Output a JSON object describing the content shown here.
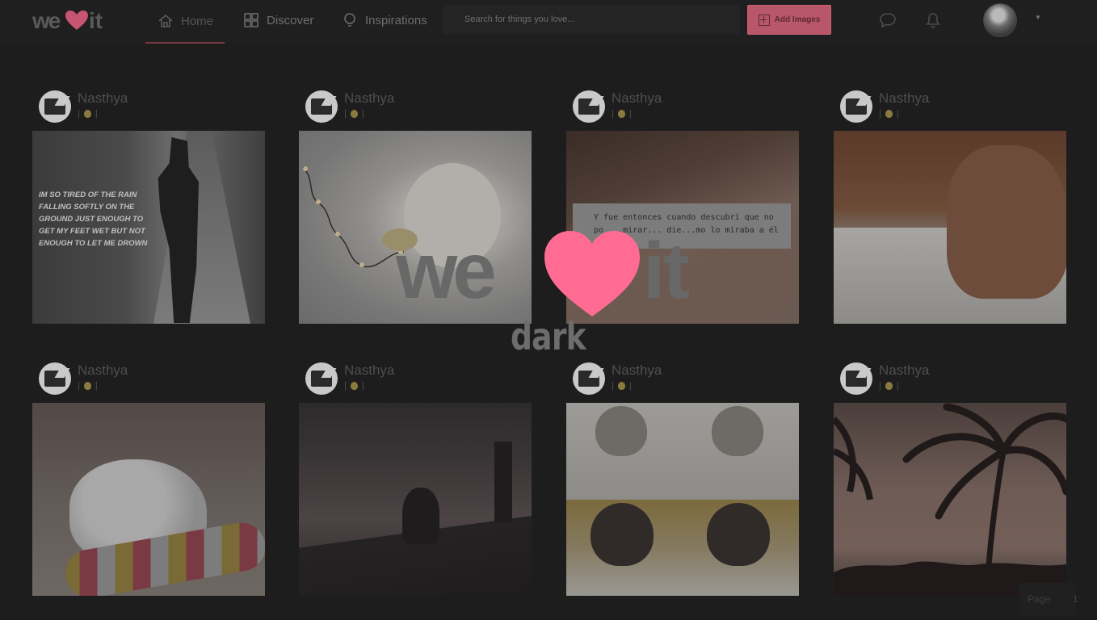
{
  "brand": {
    "logo_text": "we it",
    "heart_color": "#c75470",
    "accent": "#b8566a"
  },
  "nav": {
    "items": [
      {
        "label": "Home",
        "icon": "home-icon",
        "active": true
      },
      {
        "label": "Discover",
        "icon": "grid-icon"
      },
      {
        "label": "Inspirations",
        "icon": "lightbulb-icon"
      }
    ]
  },
  "search": {
    "placeholder": "Search for things you love..."
  },
  "toolbar": {
    "add_images_label": "Add Images"
  },
  "cards": [
    {
      "user": "Nasthya",
      "sub_left": "|",
      "sub_right": "|",
      "quote": "IM SO TIRED OF THE RAIN FALLING SOFTLY ON THE GROUND JUST ENOUGH TO GET MY FEET WET BUT NOT ENOUGH TO LET ME DROWN"
    },
    {
      "user": "Nasthya",
      "sub_left": "|",
      "sub_right": "|"
    },
    {
      "user": "Nasthya",
      "sub_left": "|",
      "sub_right": "|",
      "caption": "Y fue entonces cuando descubrí que no po  ...mirar...  die...mo lo miraba a él"
    },
    {
      "user": "Nasthya",
      "sub_left": "|",
      "sub_right": "|"
    },
    {
      "user": "Nasthya",
      "sub_left": "|",
      "sub_right": "|"
    },
    {
      "user": "Nasthya",
      "sub_left": "|",
      "sub_right": "|"
    },
    {
      "user": "Nasthya",
      "sub_left": "|",
      "sub_right": "|"
    },
    {
      "user": "Nasthya",
      "sub_left": "|",
      "sub_right": "|"
    }
  ],
  "overlay": {
    "we": "we",
    "it": "it",
    "dark": "dark",
    "heart_color": "#ff6b93"
  },
  "pager": {
    "label": "Page",
    "number": "1"
  }
}
